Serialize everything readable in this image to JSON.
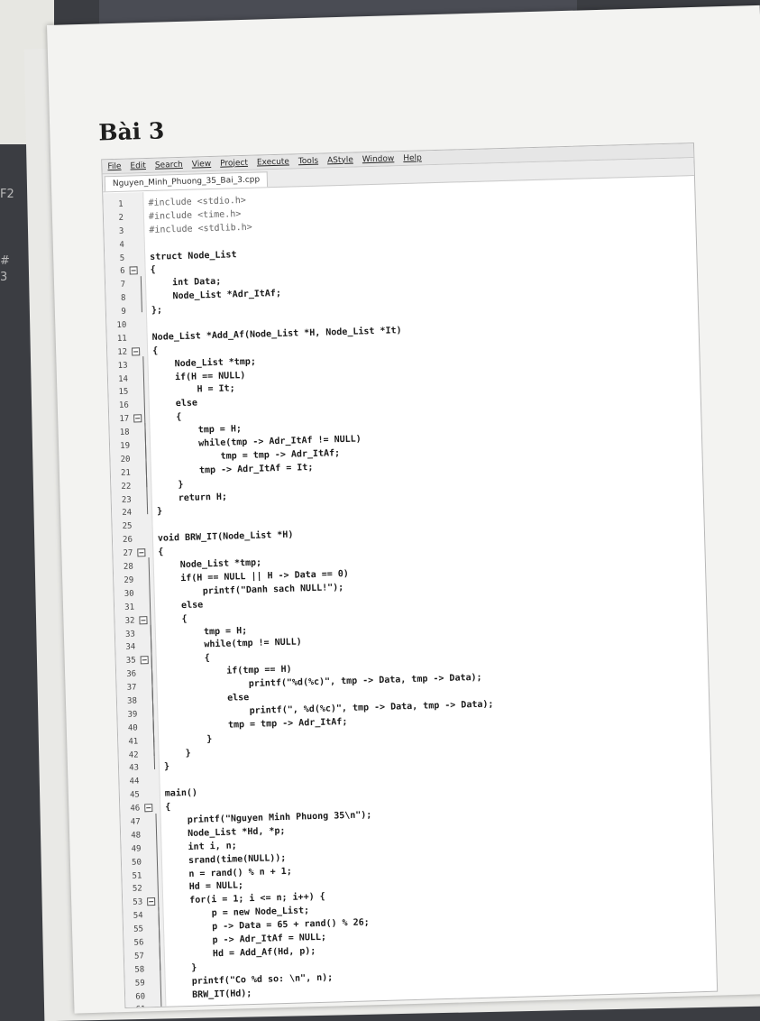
{
  "title": "Bài 3",
  "ide": {
    "menu": [
      "File",
      "Edit",
      "Search",
      "View",
      "Project",
      "Execute",
      "Tools",
      "AStyle",
      "Window",
      "Help"
    ],
    "tab": "Nguyen_Minh_Phuong_35_Bai_3.cpp"
  },
  "keys": [
    "F2",
    "#",
    "3"
  ],
  "code_lines": [
    "#include <stdio.h>",
    "#include <time.h>",
    "#include <stdlib.h>",
    "",
    "struct Node_List",
    "{",
    "    int Data;",
    "    Node_List *Adr_ItAf;",
    "};",
    "",
    "Node_List *Add_Af(Node_List *H, Node_List *It)",
    "{",
    "    Node_List *tmp;",
    "    if(H == NULL)",
    "        H = It;",
    "    else",
    "    {",
    "        tmp = H;",
    "        while(tmp -> Adr_ItAf != NULL)",
    "            tmp = tmp -> Adr_ItAf;",
    "        tmp -> Adr_ItAf = It;",
    "    }",
    "    return H;",
    "}",
    "",
    "void BRW_IT(Node_List *H)",
    "{",
    "    Node_List *tmp;",
    "    if(H == NULL || H -> Data == 0)",
    "        printf(\"Danh sach NULL!\");",
    "    else",
    "    {",
    "        tmp = H;",
    "        while(tmp != NULL)",
    "        {",
    "            if(tmp == H)",
    "                printf(\"%d(%c)\", tmp -> Data, tmp -> Data);",
    "            else",
    "                printf(\", %d(%c)\", tmp -> Data, tmp -> Data);",
    "            tmp = tmp -> Adr_ItAf;",
    "        }",
    "    }",
    "}",
    "",
    "main()",
    "{",
    "    printf(\"Nguyen Minh Phuong 35\\n\");",
    "    Node_List *Hd, *p;",
    "    int i, n;",
    "    srand(time(NULL));",
    "    n = rand() % n + 1;",
    "    Hd = NULL;",
    "    for(i = 1; i <= n; i++) {",
    "        p = new Node_List;",
    "        p -> Data = 65 + rand() % 26;",
    "        p -> Adr_ItAf = NULL;",
    "        Hd = Add_Af(Hd, p);",
    "    }",
    "    printf(\"Co %d so: \\n\", n);",
    "    BRW_IT(Hd);",
    "",
    "}"
  ],
  "fold_lines": [
    6,
    12,
    17,
    27,
    32,
    35,
    46,
    53
  ]
}
